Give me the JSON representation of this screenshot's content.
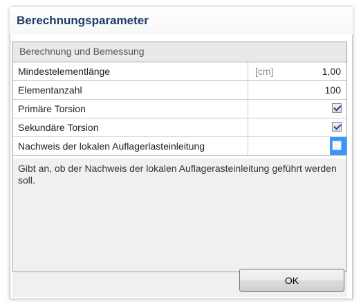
{
  "dialog": {
    "title": "Berechnungsparameter",
    "section": "Berechnung und Bemessung",
    "rows": [
      {
        "name": "Mindestelementlänge",
        "unit": "[cm]",
        "value": "1,00"
      },
      {
        "name": "Elementanzahl",
        "value": "100"
      },
      {
        "name": "Primäre Torsion",
        "checked": true
      },
      {
        "name": "Sekundäre Torsion",
        "checked": true
      },
      {
        "name": "Nachweis der lokalen Auflagerlasteinleitung",
        "checked": false,
        "selected": true
      }
    ],
    "description": "Gibt an, ob der Nachweis der lokalen Auflagerasteinleitung geführt werden soll.",
    "ok_label": "OK"
  }
}
